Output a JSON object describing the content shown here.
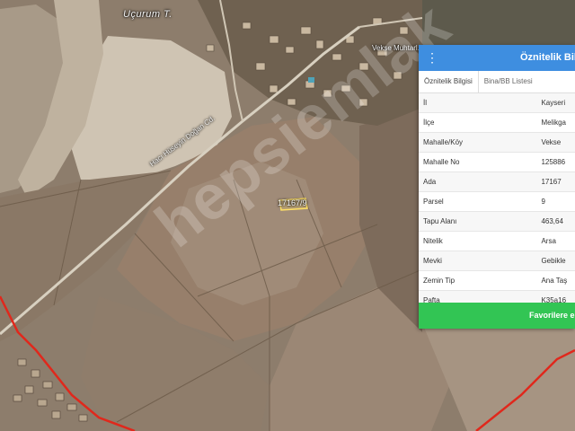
{
  "map": {
    "place_label": "Uçurum T.",
    "road_label": "Hacı Hüseyin Doğan Cd.",
    "poi_label": "Vekse Muhtarl...",
    "parcel_label": "17167/9",
    "watermark": "hepsiemlak"
  },
  "panel": {
    "title": "Öznitelik Bilgi",
    "menu_icon": "kebab-menu-icon",
    "tabs": [
      {
        "label": "Öznitelik Bilgisi",
        "active": true
      },
      {
        "label": "Bina/BB Listesi",
        "active": false
      }
    ],
    "rows": [
      {
        "key": "İl",
        "value": "Kayseri"
      },
      {
        "key": "İlçe",
        "value": "Melikga"
      },
      {
        "key": "Mahalle/Köy",
        "value": "Vekse"
      },
      {
        "key": "Mahalle No",
        "value": "125886"
      },
      {
        "key": "Ada",
        "value": "17167"
      },
      {
        "key": "Parsel",
        "value": "9"
      },
      {
        "key": "Tapu Alanı",
        "value": "463,64"
      },
      {
        "key": "Nitelik",
        "value": "Arsa"
      },
      {
        "key": "Mevki",
        "value": "Gebikle"
      },
      {
        "key": "Zemin Tip",
        "value": "Ana Taş"
      },
      {
        "key": "Pafta",
        "value": "K35a16"
      }
    ],
    "favorite_button": "Favorilere ek",
    "colors": {
      "header": "#3e8ee0",
      "button": "#32c554",
      "boundary": "#e0281c",
      "parcel": "#ffe066"
    }
  }
}
